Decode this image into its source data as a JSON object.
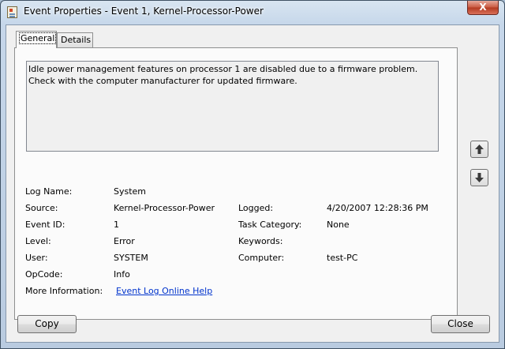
{
  "window": {
    "title": "Event Properties - Event 1, Kernel-Processor-Power",
    "close_glyph": "X"
  },
  "tabs": [
    {
      "label": "General",
      "selected": true
    },
    {
      "label": "Details",
      "selected": false
    }
  ],
  "event": {
    "message": "Idle power management features on processor 1 are disabled due to a firmware problem. Check with the computer manufacturer for updated firmware.",
    "log_name_label": "Log Name:",
    "log_name": "System",
    "source_label": "Source:",
    "source": "Kernel-Processor-Power",
    "logged_label": "Logged:",
    "logged": "4/20/2007 12:28:36 PM",
    "event_id_label": "Event ID:",
    "event_id": "1",
    "task_category_label": "Task Category:",
    "task_category": "None",
    "level_label": "Level:",
    "level": "Error",
    "keywords_label": "Keywords:",
    "keywords": "",
    "user_label": "User:",
    "user": "SYSTEM",
    "computer_label": "Computer:",
    "computer": "test-PC",
    "opcode_label": "OpCode:",
    "opcode": "Info",
    "more_info_label": "More Information:",
    "more_info_link": "Event Log Online Help"
  },
  "nav": {
    "up_glyph": "🡅",
    "down_glyph": "🡇"
  },
  "buttons": {
    "copy": "Copy",
    "close": "Close"
  }
}
